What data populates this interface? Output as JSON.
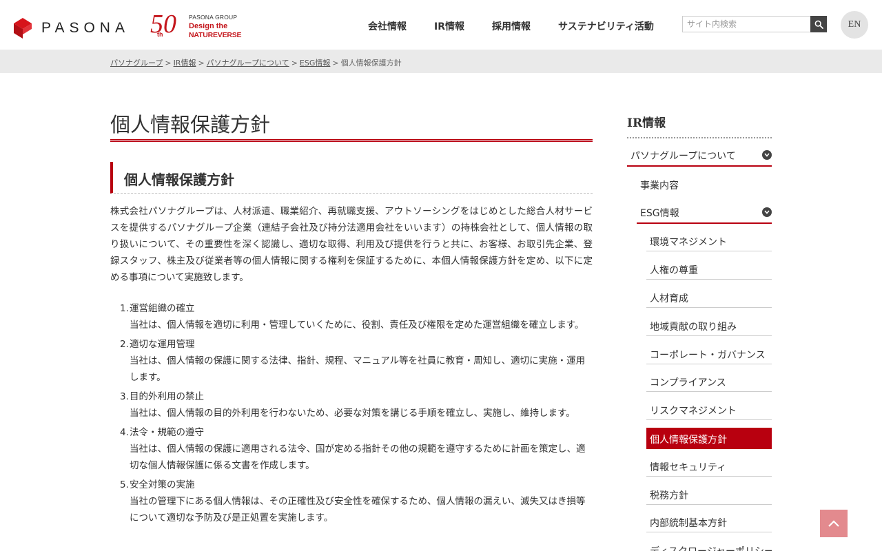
{
  "header": {
    "brand": "PASONA",
    "anniversary": {
      "number": "50",
      "suffix": "th",
      "group": "PASONA GROUP",
      "line1": "Design the",
      "line2": "NATUREVERSE"
    },
    "nav": [
      "会社情報",
      "IR情報",
      "採用情報",
      "サステナビリティ活動"
    ],
    "search_placeholder": "サイト内検索",
    "lang": "EN"
  },
  "breadcrumb": {
    "items": [
      "パソナグループ",
      "IR情報",
      "パソナグループについて",
      "ESG情報"
    ],
    "current": "個人情報保護方針",
    "separator": ">"
  },
  "main": {
    "title": "個人情報保護方針",
    "section_title": "個人情報保護方針",
    "intro": "株式会社パソナグループは、人材派遣、職業紹介、再就職支援、アウトソーシングをはじめとした総合人材サービスを提供するパソナグループ企業（連結子会社及び持分法適用会社をいいます）の持株会社として、個人情報の取り扱いについて、その重要性を深く認識し、適切な取得、利用及び提供を行うと共に、お客様、お取引先企業、登録スタッフ、株主及び従業者等の個人情報に関する権利を保証するために、本個人情報保護方針を定め、以下に定める事項について実施致します。",
    "items": [
      {
        "num": "1.",
        "heading": "運営組織の確立",
        "body": "当社は、個人情報を適切に利用・管理していくために、役割、責任及び権限を定めた運営組織を確立します。"
      },
      {
        "num": "2.",
        "heading": "適切な運用管理",
        "body": "当社は、個人情報の保護に関する法律、指針、規程、マニュアル等を社員に教育・周知し、適切に実施・運用します。"
      },
      {
        "num": "3.",
        "heading": "目的外利用の禁止",
        "body": "当社は、個人情報の目的外利用を行わないため、必要な対策を講じる手順を確立し、実施し、維持します。"
      },
      {
        "num": "4.",
        "heading": "法令・規範の遵守",
        "body": "当社は、個人情報の保護に適用される法令、国が定める指針その他の規範を遵守するために計画を策定し、適切な個人情報保護に係る文書を作成します。"
      },
      {
        "num": "5.",
        "heading": "安全対策の実施",
        "body": "当社の管理下にある個人情報は、その正確性及び安全性を確保するため、個人情報の漏えい、滅失又はき損等について適切な予防及び是正処置を実施します。"
      }
    ]
  },
  "side": {
    "title": "IR情報",
    "group1": "パソナグループについて",
    "link1": "事業内容",
    "group2": "ESG情報",
    "sub_items": [
      "環境マネジメント",
      "人権の尊重",
      "人材育成",
      "地域貢献の取り組み",
      "コーポレート・ガバナンス",
      "コンプライアンス",
      "リスクマネジメント",
      "個人情報保護方針",
      "情報セキュリティ",
      "税務方針",
      "内部統制基本方針",
      "ディスクロージャーポリシー"
    ],
    "active": "個人情報保護方針"
  },
  "colors": {
    "accent": "#b8000f",
    "brand_red": "#c4161c",
    "to_top": "#e38a8e"
  },
  "icons": {
    "search": "search-icon",
    "chevron": "chevron-down-icon",
    "to_top": "arrow-up-icon"
  }
}
